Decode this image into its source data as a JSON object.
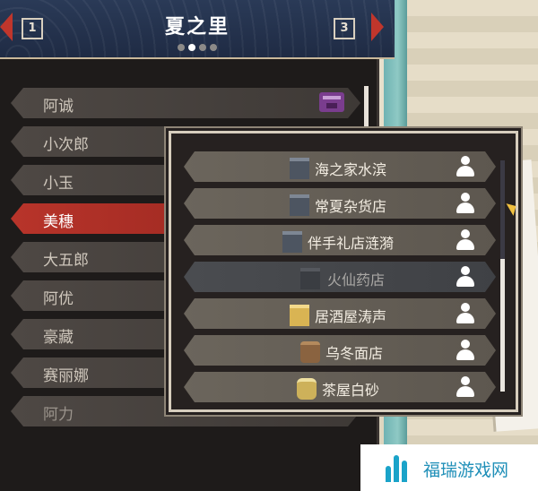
{
  "header": {
    "title": "夏之里",
    "prev_tab": "1",
    "next_tab": "3",
    "page_dots": 4,
    "active_dot": 1
  },
  "characters": [
    {
      "name": "阿诚",
      "badge": "house-icon"
    },
    {
      "name": "小次郎"
    },
    {
      "name": "小玉"
    },
    {
      "name": "美穗",
      "selected": true
    },
    {
      "name": "大五郎"
    },
    {
      "name": "阿优"
    },
    {
      "name": "豪藏"
    },
    {
      "name": "赛丽娜"
    },
    {
      "name": "阿力"
    }
  ],
  "shops": [
    {
      "name": "海之家水滨",
      "icon": "house-icon"
    },
    {
      "name": "常夏杂货店",
      "icon": "house-icon"
    },
    {
      "name": "伴手礼店涟漪",
      "icon": "house-icon"
    },
    {
      "name": "火仙药店",
      "icon": "house-icon",
      "highlighted": true
    },
    {
      "name": "居酒屋涛声",
      "icon": "inn-icon"
    },
    {
      "name": "乌冬面店",
      "icon": "noodle-cart-icon"
    },
    {
      "name": "茶屋白砂",
      "icon": "tea-house-icon"
    }
  ],
  "watermark": {
    "text": "福瑞游戏网"
  },
  "colors": {
    "selected": "#b8342a",
    "header": "#2a3a57",
    "accent_arrow": "#c0362c"
  }
}
